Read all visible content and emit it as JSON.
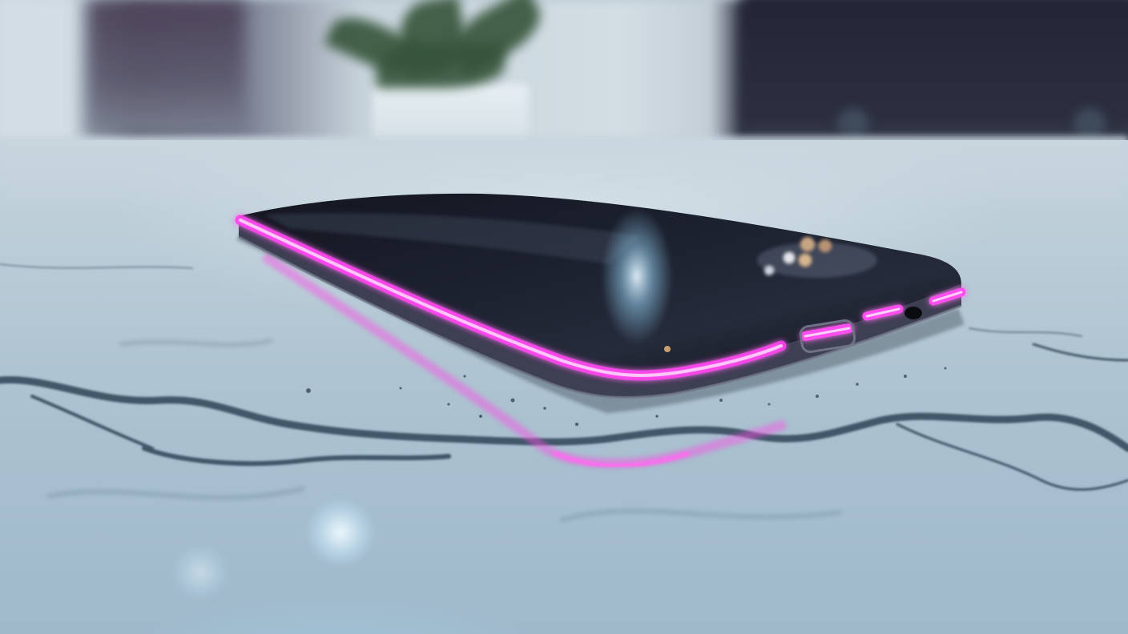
{
  "scene": {
    "subject": "smartphone",
    "setting": "marble-table",
    "colors": {
      "accent_glow": "#ff3df0",
      "phone_body": "#1b1d28",
      "marble": "#b6c9d5",
      "plant": "#35543a"
    }
  }
}
